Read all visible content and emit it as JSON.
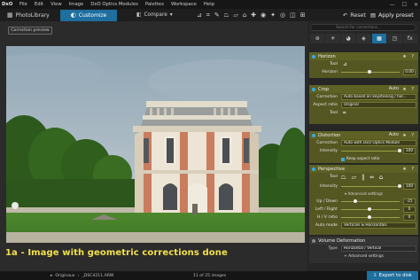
{
  "menubar": {
    "logo": "DxO",
    "items": [
      "File",
      "Edit",
      "View",
      "Image",
      "DxO Optics Modules",
      "Palettes",
      "Workspace",
      "Help"
    ]
  },
  "toolbar": {
    "library_label": "PhotoLibrary",
    "customize_label": "Customize",
    "compare_label": "Compare",
    "reset_label": "Reset",
    "apply_label": "Apply preset"
  },
  "viewer": {
    "correction_preview_label": "Correction preview",
    "caption": "1a - Image with geometric corrections done"
  },
  "status": {
    "folder": "Originaux",
    "file": "_DSC4211.ARW",
    "count": "11 of 25 images",
    "export_label": "Export to disk"
  },
  "panel": {
    "search_placeholder": "Search for corrections...",
    "horizon": {
      "title": "Horizon",
      "tool_label": "Tool",
      "horizon_label": "Horizon",
      "horizon_value": "0.00"
    },
    "crop": {
      "title": "Crop",
      "auto_label": "Auto",
      "correction_label": "Correction",
      "correction_value": "Auto based on keystoning / hor...",
      "aspect_label": "Aspect ratio",
      "aspect_value": "Original",
      "tool_label": "Tool"
    },
    "distortion": {
      "title": "Distortion",
      "auto_label": "Auto",
      "correction_label": "Correction",
      "correction_value": "Auto with DxO Optics Module",
      "intensity_label": "Intensity",
      "intensity_value": "100",
      "intensity_level": 1.0,
      "keep_label": "Keep aspect ratio"
    },
    "perspective": {
      "title": "Perspective",
      "tool_label": "Tool",
      "intensity_label": "Intensity",
      "intensity_value": "100",
      "intensity_level": 1.0,
      "advanced_label": "Advanced settings",
      "updown_label": "Up / Down",
      "updown_value": "-25",
      "leftright_label": "Left / Right",
      "leftright_value": "0",
      "hv_label": "H / V ratio",
      "hv_value": "0",
      "automode_label": "Auto mode",
      "automode_value": "Verticals & Horizontals"
    },
    "volume": {
      "title": "Volume Deformation",
      "type_label": "Type",
      "type_value": "Horizontal / Vertical",
      "advanced_label": "+ Advanced settings"
    }
  }
}
